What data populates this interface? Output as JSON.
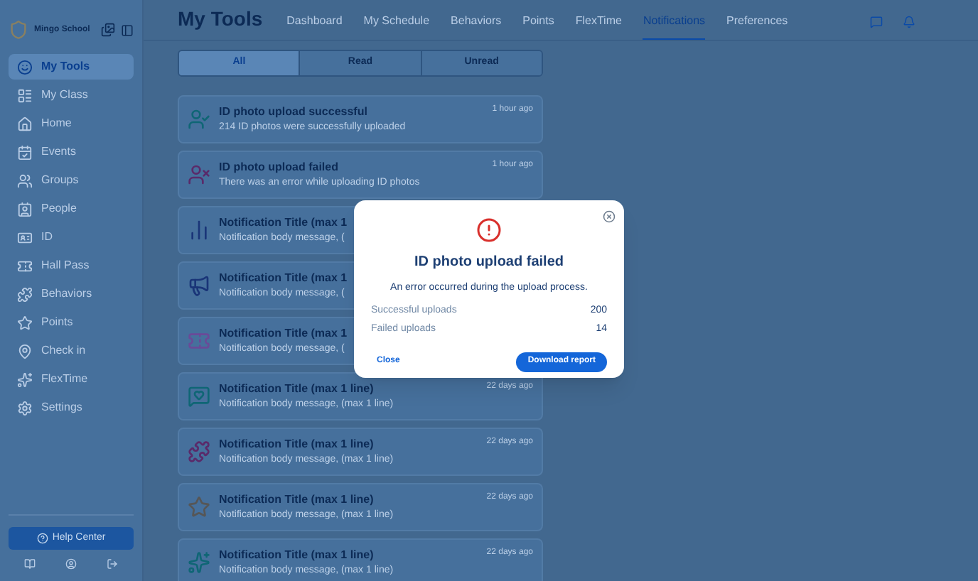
{
  "sidebar": {
    "school": "Mingo School",
    "items": [
      {
        "label": "My Tools",
        "selected": true
      },
      {
        "label": "My Class",
        "selected": false
      },
      {
        "label": "Home",
        "selected": false
      },
      {
        "label": "Events",
        "selected": false
      },
      {
        "label": "Groups",
        "selected": false
      },
      {
        "label": "People",
        "selected": false
      },
      {
        "label": "ID",
        "selected": false
      },
      {
        "label": "Hall Pass",
        "selected": false
      },
      {
        "label": "Behaviors",
        "selected": false
      },
      {
        "label": "Points",
        "selected": false
      },
      {
        "label": "Check in",
        "selected": false
      },
      {
        "label": "FlexTime",
        "selected": false
      },
      {
        "label": "Settings",
        "selected": false
      }
    ],
    "help": "Help Center"
  },
  "header": {
    "title": "My Tools",
    "tabs": [
      {
        "label": "Dashboard",
        "selected": false
      },
      {
        "label": "My Schedule",
        "selected": false
      },
      {
        "label": "Behaviors",
        "selected": false
      },
      {
        "label": "Points",
        "selected": false
      },
      {
        "label": "FlexTime",
        "selected": false
      },
      {
        "label": "Notifications",
        "selected": true
      },
      {
        "label": "Preferences",
        "selected": false
      }
    ]
  },
  "filter": [
    {
      "label": "All",
      "selected": true
    },
    {
      "label": "Read",
      "selected": false
    },
    {
      "label": "Unread",
      "selected": false
    }
  ],
  "notifications": [
    {
      "kind": "id-success",
      "title": "ID photo upload successful",
      "body": "214 ID photos were successfully uploaded",
      "time": "1 hour ago"
    },
    {
      "kind": "id-failed",
      "title": "ID photo upload failed",
      "body": "There was an error while uploading ID photos",
      "time": "1 hour ago"
    },
    {
      "kind": "chart",
      "title": "Notification Title (max 1",
      "body": "Notification body message, ("
    },
    {
      "kind": "megaphone",
      "title": "Notification Title (max 1",
      "body": "Notification body message, ("
    },
    {
      "kind": "ticket",
      "title": "Notification Title (max 1",
      "body": "Notification body message, ("
    },
    {
      "kind": "chat",
      "title": "Notification Title (max 1 line)",
      "body": "Notification body message, (max 1 line)",
      "time": "22 days ago"
    },
    {
      "kind": "puzzle",
      "title": "Notification Title (max 1 line)",
      "body": "Notification body message, (max 1 line)",
      "time": "22 days ago"
    },
    {
      "kind": "star",
      "title": "Notification Title (max 1 line)",
      "body": "Notification body message, (max 1 line)",
      "time": "22 days ago"
    },
    {
      "kind": "flex",
      "title": "Notification Title (max 1 line)",
      "body": "Notification body message, (max 1 line)",
      "time": "22 days ago"
    }
  ],
  "dialog": {
    "title": "ID photo upload failed",
    "message": "An error occurred during the upload process.",
    "stats": [
      {
        "label": "Successful uploads",
        "value": "200"
      },
      {
        "label": "Failed uploads",
        "value": "14"
      }
    ],
    "close": "Close",
    "action": "Download report"
  }
}
